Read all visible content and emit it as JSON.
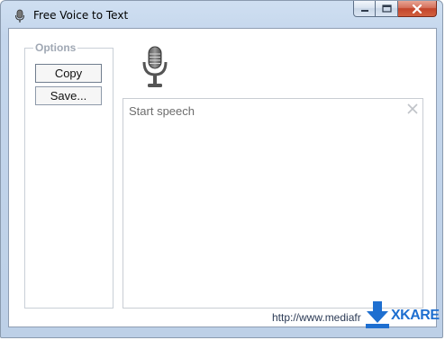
{
  "window": {
    "title": "Free Voice to Text",
    "icon": "microphone-icon"
  },
  "caption_buttons": {
    "minimize_icon": "minimize-icon",
    "maximize_icon": "maximize-icon",
    "close_icon": "close-icon"
  },
  "options": {
    "legend": "Options",
    "copy_label": "Copy",
    "save_label": "Save..."
  },
  "speech": {
    "mic_icon": "microphone-icon",
    "placeholder": "Start speech",
    "clear_icon": "clear-x-icon"
  },
  "footer": {
    "url_text": "http://www.mediafr",
    "watermark_text": "XKARE"
  },
  "colors": {
    "title_bar": "#c4d6ec",
    "close_button": "#c2452b",
    "watermark": "#1e6fd0"
  }
}
